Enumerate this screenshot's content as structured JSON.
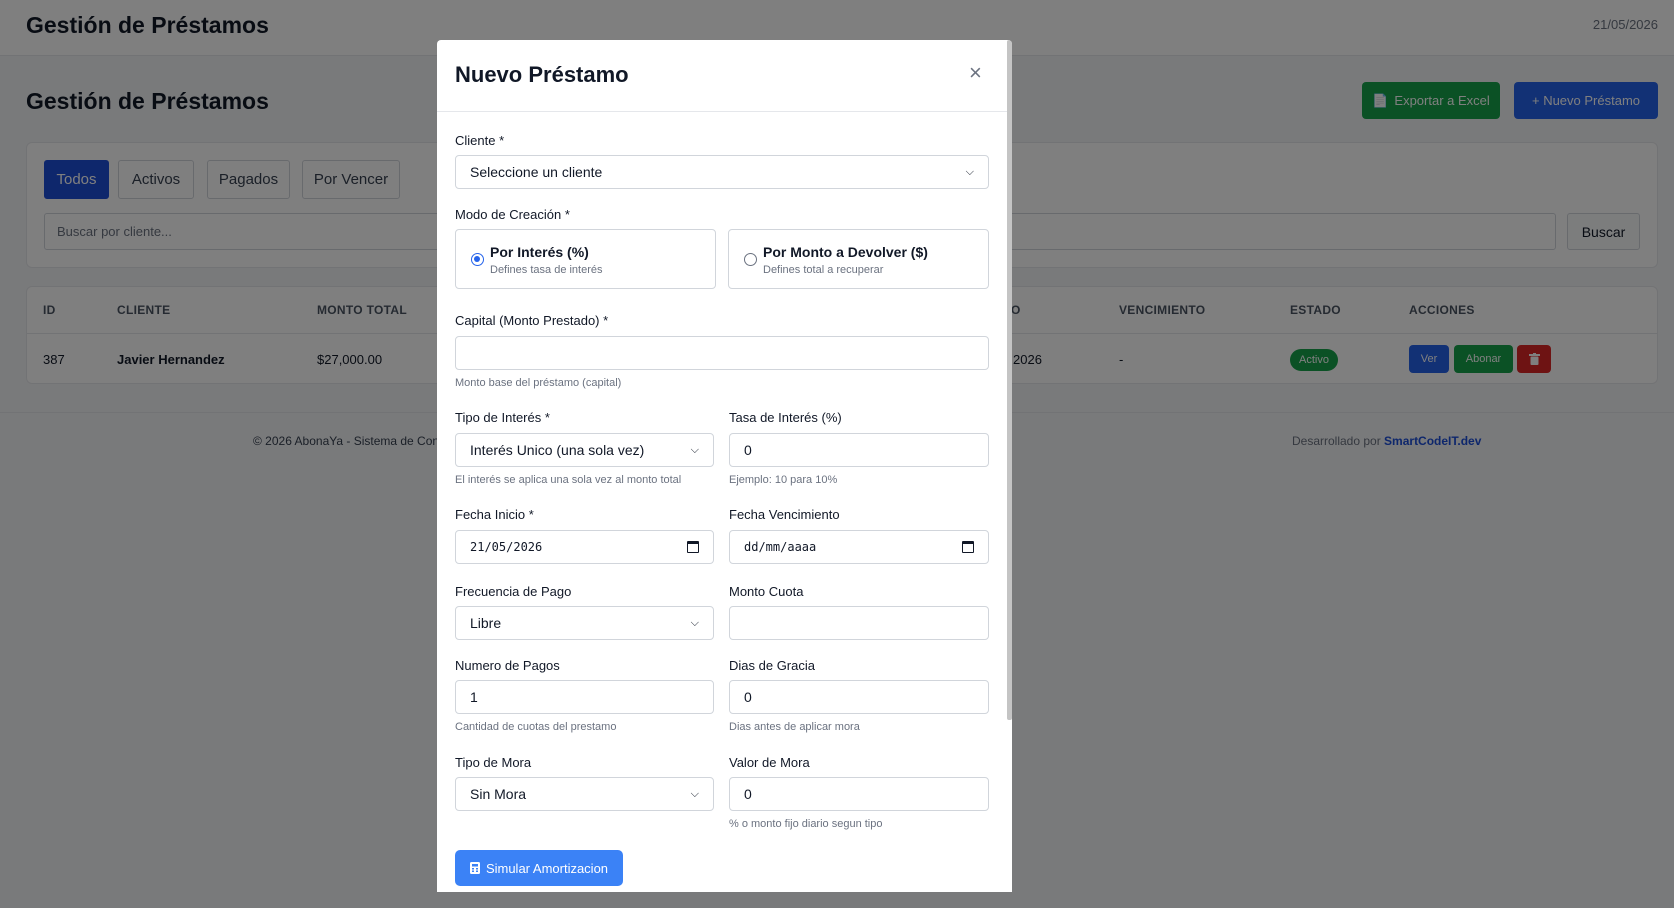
{
  "header": {
    "app_title": "Gestión de Préstamos",
    "date": "21/05/2026"
  },
  "page": {
    "title": "Gestión de Préstamos",
    "export_label": "Exportar a Excel",
    "new_label": "+ Nuevo Préstamo"
  },
  "filters": {
    "tabs": [
      "Todos",
      "Activos",
      "Pagados",
      "Por Vencer"
    ],
    "active_tab": "Todos",
    "search_placeholder": "Buscar por cliente...",
    "search_button": "Buscar"
  },
  "table": {
    "columns": {
      "id": "ID",
      "cliente": "CLIENTE",
      "monto_total": "MONTO TOTAL",
      "col4_partial": "O",
      "vencimiento": "VENCIMIENTO",
      "estado": "ESTADO",
      "acciones": "ACCIONES"
    },
    "row": {
      "id": "387",
      "cliente": "Javier Hernandez",
      "monto_total": "$27,000.00",
      "fecha_partial": "2026",
      "vencimiento": "-",
      "estado": "Activo",
      "ver": "Ver",
      "abonar": "Abonar"
    }
  },
  "footer": {
    "left": "© 2026 AbonaYa - Sistema de Con",
    "right_prefix": "Desarrollado por ",
    "right_link": "SmartCodeIT.dev"
  },
  "modal": {
    "title": "Nuevo Préstamo",
    "close": "×",
    "cliente_label": "Cliente *",
    "cliente_value": "Seleccione un cliente",
    "modo_label": "Modo de Creación *",
    "modo_interes_title": "Por Interés (%)",
    "modo_interes_sub": "Defines tasa de interés",
    "modo_monto_title": "Por Monto a Devolver ($)",
    "modo_monto_sub": "Defines total a recuperar",
    "modo_selected": "Por Interés (%)",
    "capital_label": "Capital (Monto Prestado) *",
    "capital_value": "",
    "capital_help": "Monto base del préstamo (capital)",
    "tipo_interes_label": "Tipo de Interés *",
    "tipo_interes_value": "Interés Unico (una sola vez)",
    "tipo_interes_help": "El interés se aplica una sola vez al monto total",
    "tasa_label": "Tasa de Interés (%)",
    "tasa_value": "0",
    "tasa_help": "Ejemplo: 10 para 10%",
    "fecha_inicio_label": "Fecha Inicio *",
    "fecha_inicio_value": "21/05/2026",
    "fecha_venc_label": "Fecha Vencimiento",
    "fecha_venc_value": "dd/mm/aaaa",
    "frecuencia_label": "Frecuencia de Pago",
    "frecuencia_value": "Libre",
    "cuota_label": "Monto Cuota",
    "cuota_value": "",
    "num_pagos_label": "Numero de Pagos",
    "num_pagos_value": "1",
    "num_pagos_help": "Cantidad de cuotas del prestamo",
    "dias_gracia_label": "Dias de Gracia",
    "dias_gracia_value": "0",
    "dias_gracia_help": "Dias antes de aplicar mora",
    "tipo_mora_label": "Tipo de Mora",
    "tipo_mora_value": "Sin Mora",
    "valor_mora_label": "Valor de Mora",
    "valor_mora_value": "0",
    "valor_mora_help": "% o monto fijo diario segun tipo",
    "simular_label": "Simular Amortizacion"
  }
}
